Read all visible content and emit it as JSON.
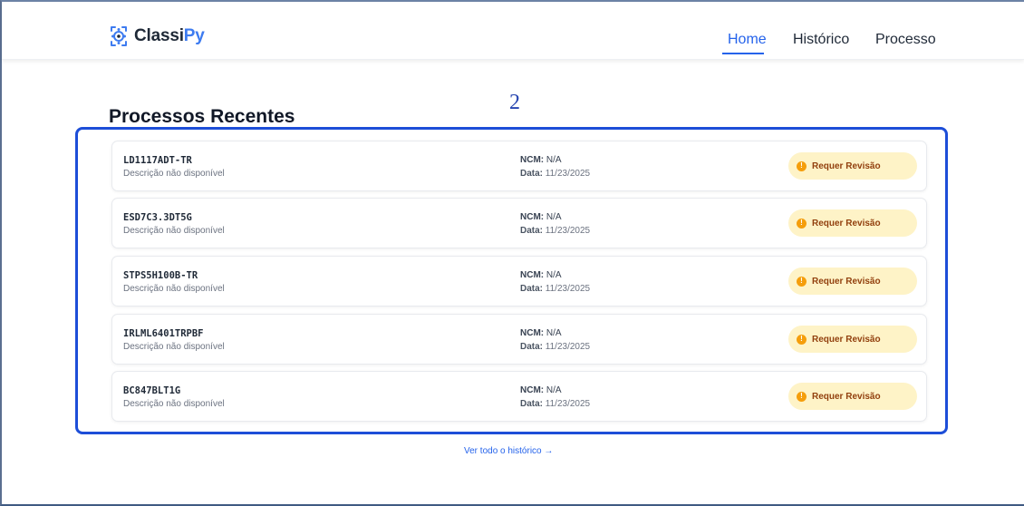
{
  "brand": {
    "name_main": "Classi",
    "name_accent": "Py"
  },
  "nav": {
    "items": [
      {
        "label": "Home",
        "active": true
      },
      {
        "label": "Histórico",
        "active": false
      },
      {
        "label": "Processo",
        "active": false
      }
    ]
  },
  "annotation_marker": "2",
  "section_title": "Processos Recentes",
  "records": [
    {
      "code": "LD1117ADT-TR",
      "description": "Descrição não disponível",
      "ncm_label": "NCM:",
      "ncm_value": "N/A",
      "date_label": "Data:",
      "date_value": "11/23/2025",
      "status": "Requer Revisão"
    },
    {
      "code": "ESD7C3.3DT5G",
      "description": "Descrição não disponível",
      "ncm_label": "NCM:",
      "ncm_value": "N/A",
      "date_label": "Data:",
      "date_value": "11/23/2025",
      "status": "Requer Revisão"
    },
    {
      "code": "STPS5H100B-TR",
      "description": "Descrição não disponível",
      "ncm_label": "NCM:",
      "ncm_value": "N/A",
      "date_label": "Data:",
      "date_value": "11/23/2025",
      "status": "Requer Revisão"
    },
    {
      "code": "IRLML6401TRPBF",
      "description": "Descrição não disponível",
      "ncm_label": "NCM:",
      "ncm_value": "N/A",
      "date_label": "Data:",
      "date_value": "11/23/2025",
      "status": "Requer Revisão"
    },
    {
      "code": "BC847BLT1G",
      "description": "Descrição não disponível",
      "ncm_label": "NCM:",
      "ncm_value": "N/A",
      "date_label": "Data:",
      "date_value": "11/23/2025",
      "status": "Requer Revisão"
    }
  ],
  "status_icon": "exclamation-icon",
  "view_all_link": "Ver todo o histórico →",
  "colors": {
    "accent": "#2563eb",
    "brand_accent": "#3d7bf0",
    "badge_bg": "#fef3c7",
    "badge_text": "#92400e",
    "badge_icon": "#f59e0b",
    "highlight": "#1d4ed8"
  }
}
